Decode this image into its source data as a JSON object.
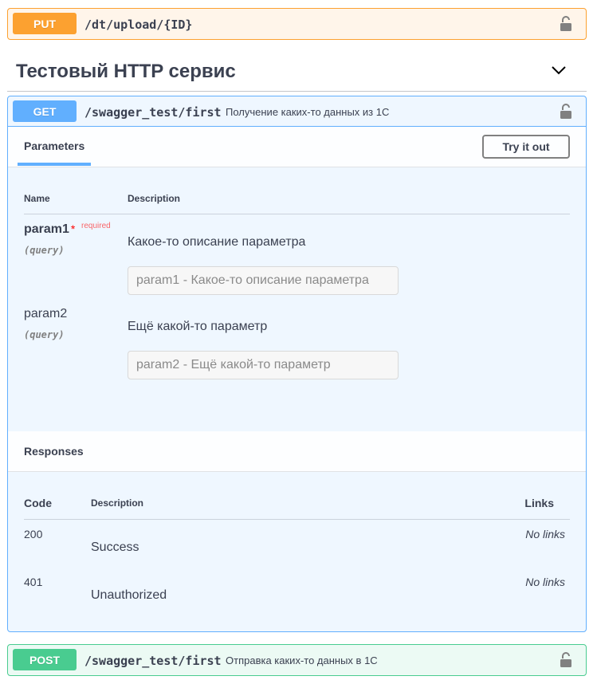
{
  "put": {
    "method": "PUT",
    "path": "/dt/upload/{ID}",
    "description": ""
  },
  "tag": {
    "title": "Тестовый HTTP сервис"
  },
  "get": {
    "method": "GET",
    "path": "/swagger_test/first",
    "description": "Получение каких-то данных из 1С",
    "params_tab": "Parameters",
    "try_label": "Try it out",
    "col_name": "Name",
    "col_description": "Description",
    "params": [
      {
        "name": "param1",
        "star": "*",
        "required": "required",
        "in": "(query)",
        "description": "Какое-то описание параметра",
        "placeholder": "param1 - Какое-то описание параметра"
      },
      {
        "name": "param2",
        "in": "(query)",
        "description": "Ещё какой-то параметр",
        "placeholder": "param2 - Ещё какой-то параметр"
      }
    ],
    "responses_title": "Responses",
    "resp_col_code": "Code",
    "resp_col_description": "Description",
    "resp_col_links": "Links",
    "responses": [
      {
        "code": "200",
        "description": "Success",
        "links": "No links"
      },
      {
        "code": "401",
        "description": "Unauthorized",
        "links": "No links"
      }
    ]
  },
  "post": {
    "method": "POST",
    "path": "/swagger_test/first",
    "description": "Отправка каких-то данных в 1С"
  },
  "colors": {
    "put": "#fca130",
    "get": "#61affe",
    "post": "#49cc90"
  }
}
